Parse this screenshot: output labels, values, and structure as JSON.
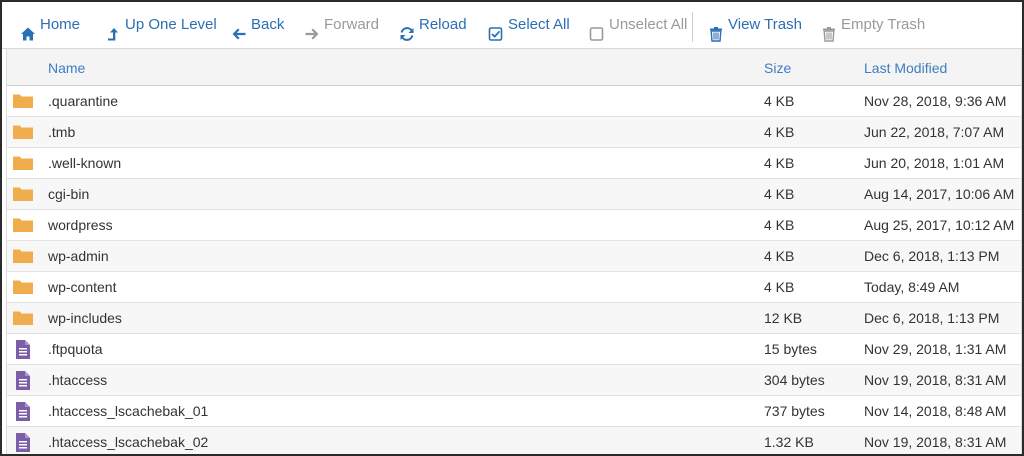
{
  "colors": {
    "link": "#2a6fb5",
    "disabled": "#9a9a9a",
    "header_text": "#3d7ec2",
    "folder": "#f0ad4e",
    "file": "#7b5ea7"
  },
  "toolbar": {
    "home": {
      "label": "Home",
      "icon": "home-icon"
    },
    "up_one_level": {
      "label": "Up One Level",
      "icon": "level-up-icon"
    },
    "back": {
      "label": "Back",
      "icon": "arrow-left-icon"
    },
    "forward": {
      "label": "Forward",
      "icon": "arrow-right-icon"
    },
    "reload": {
      "label": "Reload",
      "icon": "refresh-icon"
    },
    "select_all": {
      "label": "Select All",
      "icon": "checked-box-icon"
    },
    "unselect_all": {
      "label": "Unselect All",
      "icon": "empty-box-icon"
    },
    "view_trash": {
      "label": "View Trash",
      "icon": "trash-icon"
    },
    "empty_trash": {
      "label": "Empty Trash",
      "icon": "trash-icon"
    }
  },
  "table": {
    "columns": {
      "name": "Name",
      "size": "Size",
      "last_modified": "Last Modified"
    },
    "rows": [
      {
        "type": "folder",
        "name": ".quarantine",
        "size": "4 KB",
        "modified": "Nov 28, 2018, 9:36 AM"
      },
      {
        "type": "folder",
        "name": ".tmb",
        "size": "4 KB",
        "modified": "Jun 22, 2018, 7:07 AM"
      },
      {
        "type": "folder",
        "name": ".well-known",
        "size": "4 KB",
        "modified": "Jun 20, 2018, 1:01 AM"
      },
      {
        "type": "folder",
        "name": "cgi-bin",
        "size": "4 KB",
        "modified": "Aug 14, 2017, 10:06 AM"
      },
      {
        "type": "folder",
        "name": "wordpress",
        "size": "4 KB",
        "modified": "Aug 25, 2017, 10:12 AM"
      },
      {
        "type": "folder",
        "name": "wp-admin",
        "size": "4 KB",
        "modified": "Dec 6, 2018, 1:13 PM"
      },
      {
        "type": "folder",
        "name": "wp-content",
        "size": "4 KB",
        "modified": "Today, 8:49 AM"
      },
      {
        "type": "folder",
        "name": "wp-includes",
        "size": "12 KB",
        "modified": "Dec 6, 2018, 1:13 PM"
      },
      {
        "type": "file",
        "name": ".ftpquota",
        "size": "15 bytes",
        "modified": "Nov 29, 2018, 1:31 AM"
      },
      {
        "type": "file",
        "name": ".htaccess",
        "size": "304 bytes",
        "modified": "Nov 19, 2018, 8:31 AM"
      },
      {
        "type": "file",
        "name": ".htaccess_lscachebak_01",
        "size": "737 bytes",
        "modified": "Nov 14, 2018, 8:48 AM"
      },
      {
        "type": "file",
        "name": ".htaccess_lscachebak_02",
        "size": "1.32 KB",
        "modified": "Nov 19, 2018, 8:31 AM"
      }
    ]
  }
}
